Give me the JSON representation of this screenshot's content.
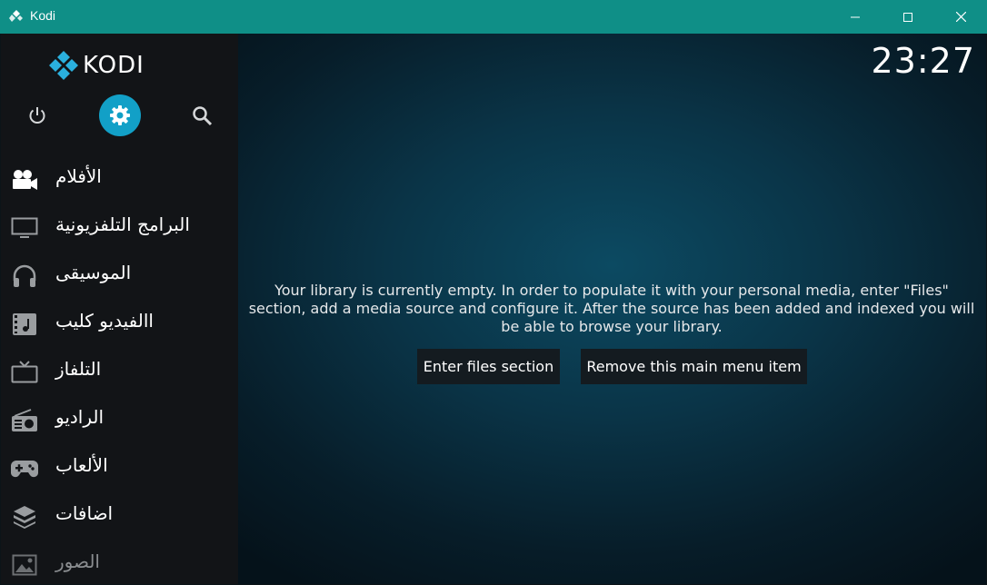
{
  "window": {
    "title": "Kodi"
  },
  "sidebar": {
    "logo_text": "KODI",
    "items": [
      {
        "label": "الأفلام",
        "icon": "movie-camera-icon"
      },
      {
        "label": "البرامج التلفزيونية",
        "icon": "monitor-icon"
      },
      {
        "label": "الموسيقى",
        "icon": "headphones-icon"
      },
      {
        "label": "االفيديو كليب",
        "icon": "music-video-icon"
      },
      {
        "label": "التلفاز",
        "icon": "tv-icon"
      },
      {
        "label": "الراديو",
        "icon": "radio-icon"
      },
      {
        "label": "الألعاب",
        "icon": "gamepad-icon"
      },
      {
        "label": "اضافات",
        "icon": "addons-box-icon"
      },
      {
        "label": "الصور",
        "icon": "pictures-icon"
      }
    ]
  },
  "header": {
    "clock": "23:27"
  },
  "main": {
    "message": "Your library is currently empty. In order to populate it with your personal media, enter \"Files\" section, add a media source and configure it. After the source has been added and indexed you will be able to browse your library.",
    "enter_files_label": "Enter files section",
    "remove_item_label": "Remove this main menu item"
  },
  "colors": {
    "titlebar": "#0f8f87",
    "accent": "#12a0c7",
    "sidebar": "#121417"
  }
}
